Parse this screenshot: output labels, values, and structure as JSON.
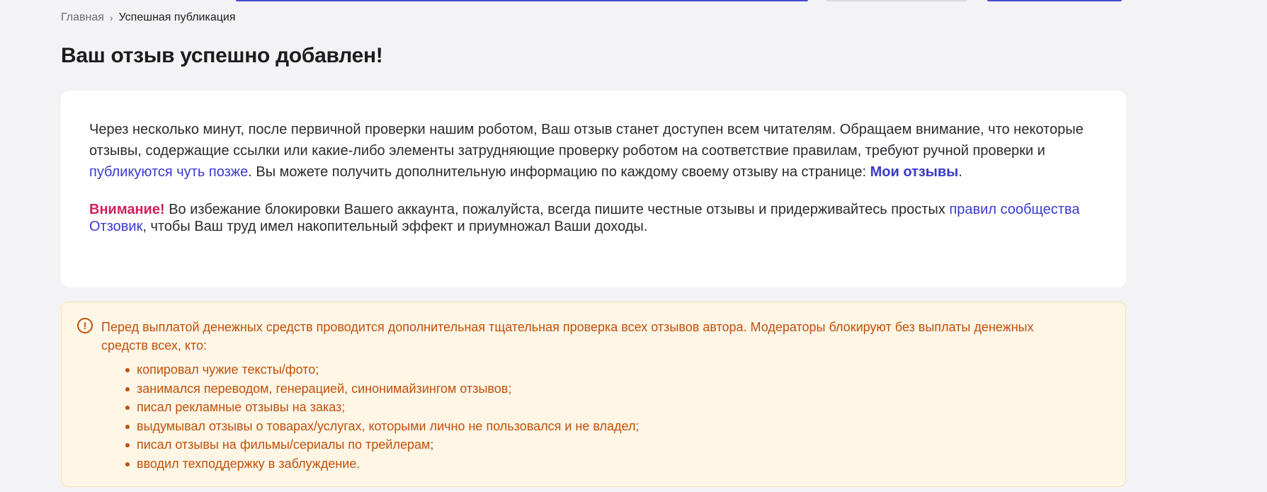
{
  "colors": {
    "background": "#f3f3f6",
    "accent_link": "#3a3ad0",
    "attention": "#d0215c",
    "warning_text": "#c1500b",
    "warning_bg": "#fff6e6"
  },
  "breadcrumb": {
    "home": "Главная",
    "separator": "›",
    "current": "Успешная публикация"
  },
  "page_title": "Ваш отзыв успешно добавлен!",
  "info_card": {
    "paragraph1": {
      "text_a": "Через несколько минут, после первичной проверки нашим роботом, Ваш отзыв станет доступен всем читателям. Обращаем внимание, что некоторые отзывы, содержащие ссылки или какие-либо элементы затрудняющие проверку роботом на соответствие правилам, требуют ручной проверки и ",
      "link_later": "публикуются чуть позже",
      "text_b": ". Вы можете получить дополнительную информацию по каждому своему отзыву на странице: ",
      "link_my_reviews": "Мои отзывы",
      "text_c": "."
    },
    "paragraph2": {
      "attention": "Внимание!",
      "text_a": " Во избежание блокировки Вашего аккаунта, пожалуйста, всегда пишите честные отзывы и придерживайтесь простых ",
      "link_rules": "правил сообщества Отзовик",
      "text_b": ", чтобы Ваш труд имел накопительный эффект и приумножал Ваши доходы."
    }
  },
  "warning": {
    "icon": "exclamation-circle-icon",
    "icon_glyph": "!",
    "intro": "Перед выплатой денежных средств проводится дополнительная тщательная проверка всех отзывов автора. Модераторы блокируют без выплаты денежных средств всех, кто:",
    "items": [
      "копировал чужие тексты/фото;",
      "занимался переводом, генерацией, синонимайзингом отзывов;",
      "писал рекламные отзывы на заказ;",
      "выдумывал отзывы о товарах/услугах, которыми лично не пользовался и не владел;",
      "писал отзывы на фильмы/сериалы по трейлерам;",
      "вводил техподдержку в заблуждение."
    ]
  }
}
